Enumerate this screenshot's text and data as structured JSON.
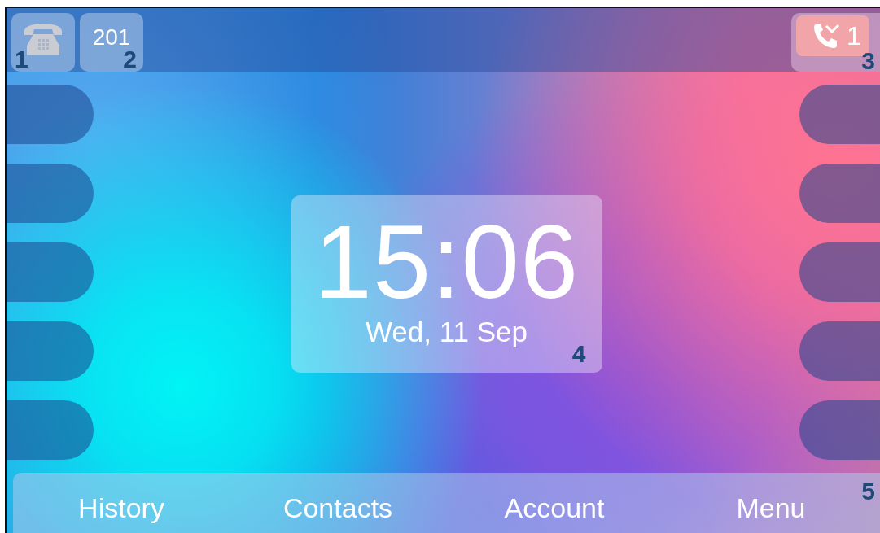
{
  "status_bar": {
    "phone_tile": {
      "callout": "1"
    },
    "account_tile": {
      "label": "201",
      "callout": "2"
    },
    "missed_calls_tile": {
      "count": "1",
      "callout": "3"
    }
  },
  "clock": {
    "time": "15:06",
    "date": "Wed, 11 Sep",
    "callout": "4"
  },
  "softkeys": {
    "labels": [
      "History",
      "Contacts",
      "Account",
      "Menu"
    ],
    "callout": "5"
  }
}
